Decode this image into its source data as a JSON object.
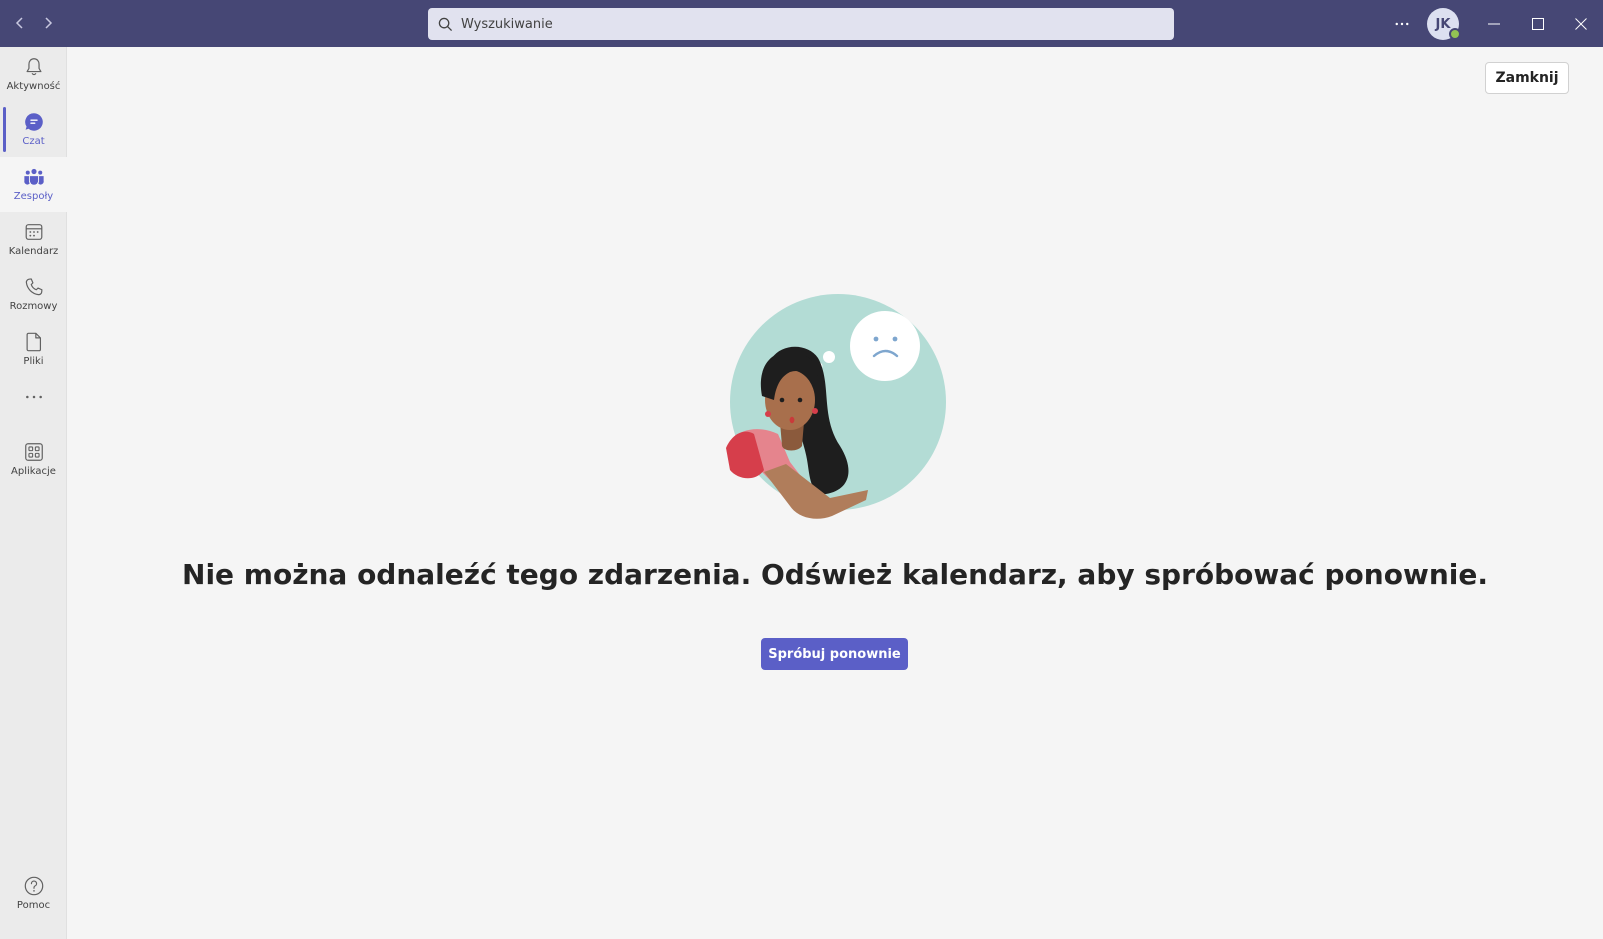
{
  "search": {
    "placeholder": "Wyszukiwanie"
  },
  "user": {
    "initials": "JK"
  },
  "rail": {
    "activity": "Aktywność",
    "chat": "Czat",
    "teams": "Zespoły",
    "calendar": "Kalendarz",
    "calls": "Rozmowy",
    "files": "Pliki",
    "apps": "Aplikacje",
    "help": "Pomoc"
  },
  "main": {
    "close_label": "Zamknij",
    "error_message": "Nie można odnaleźć tego zdarzenia. Odśwież kalendarz, aby spróbować ponownie.",
    "retry_label": "Spróbuj ponownie"
  },
  "colors": {
    "titlebar": "#464775",
    "accent": "#5b5fc7",
    "background": "#f5f5f5"
  },
  "icons": [
    "back-icon",
    "forward-icon",
    "search-icon",
    "more-icon",
    "minimize-icon",
    "maximize-icon",
    "close-icon",
    "bell-icon",
    "chat-icon",
    "teams-icon",
    "calendar-icon",
    "phone-icon",
    "file-icon",
    "apps-icon",
    "help-icon"
  ]
}
